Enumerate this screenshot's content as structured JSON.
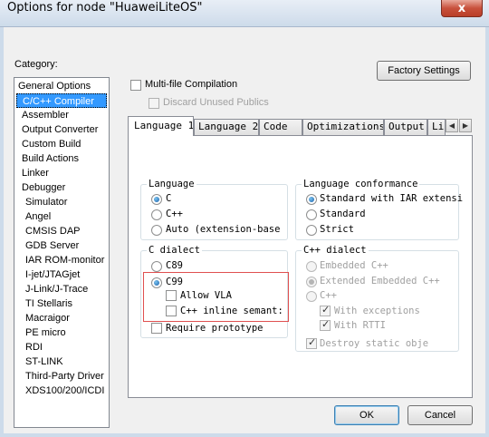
{
  "window": {
    "title": "Options for node \"HuaweiLiteOS\"",
    "close_glyph": "x"
  },
  "category": {
    "label": "Category:",
    "items": [
      "General Options",
      "C/C++ Compiler",
      "Assembler",
      "Output Converter",
      "Custom Build",
      "Build Actions",
      "Linker",
      "Debugger",
      "Simulator",
      "Angel",
      "CMSIS DAP",
      "GDB Server",
      "IAR ROM-monitor",
      "I-jet/JTAGjet",
      "J-Link/J-Trace",
      "TI Stellaris",
      "Macraigor",
      "PE micro",
      "RDI",
      "ST-LINK",
      "Third-Party Driver",
      "XDS100/200/ICDI"
    ],
    "selected_index": 1
  },
  "factory_settings_label": "Factory Settings",
  "multi_file": {
    "label": "Multi-file Compilation",
    "checked": false
  },
  "discard_unused": {
    "label": "Discard Unused Publics",
    "checked": false,
    "disabled": true
  },
  "tabs": [
    "Language 1",
    "Language 2",
    "Code",
    "Optimizations",
    "Output",
    "Li"
  ],
  "scroll": {
    "left": "◀",
    "right": "▶"
  },
  "language": {
    "title": "Language",
    "options": [
      "C",
      "C++",
      "Auto (extension-base"
    ],
    "selected_index": 0
  },
  "language_conformance": {
    "title": "Language conformance",
    "options": [
      "Standard with IAR extensi",
      "Standard",
      "Strict"
    ],
    "selected_index": 0
  },
  "c_dialect": {
    "title": "C dialect",
    "options": [
      "C89",
      "C99"
    ],
    "selected_index": 1,
    "allow_vla": "Allow VLA",
    "cpp_inline": "C++ inline semant:",
    "require_prototype": "Require prototype"
  },
  "cpp_dialect": {
    "title": "C++ dialect",
    "options": [
      "Embedded C++",
      "Extended Embedded C++",
      "C++"
    ],
    "selected_index": 1,
    "with_exceptions": "With exceptions",
    "with_rtti": "With RTTI",
    "destroy_static": "Destroy static obje"
  },
  "buttons": {
    "ok": "OK",
    "cancel": "Cancel"
  }
}
